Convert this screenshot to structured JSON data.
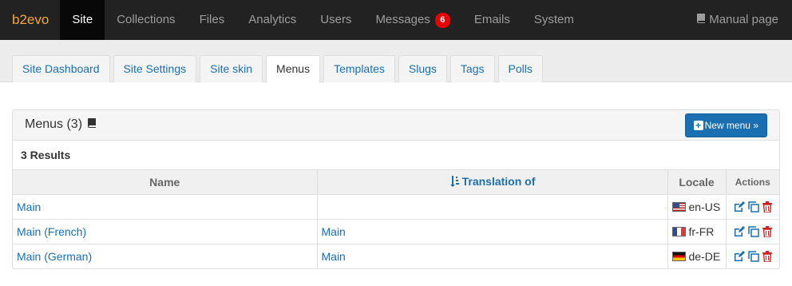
{
  "nav": {
    "brand": "b2evo",
    "items": [
      {
        "label": "Site",
        "active": true
      },
      {
        "label": "Collections"
      },
      {
        "label": "Files"
      },
      {
        "label": "Analytics"
      },
      {
        "label": "Users"
      },
      {
        "label": "Messages",
        "badge": "6"
      },
      {
        "label": "Emails"
      },
      {
        "label": "System"
      }
    ],
    "manual_label": "Manual page"
  },
  "tabs": [
    "Site Dashboard",
    "Site Settings",
    "Site skin",
    "Menus",
    "Templates",
    "Slugs",
    "Tags",
    "Polls"
  ],
  "active_tab": "Menus",
  "panel": {
    "title": "Menus (3)",
    "new_button": "New menu »",
    "results": "3 Results"
  },
  "table": {
    "headers": {
      "name": "Name",
      "translation": "Translation of",
      "locale": "Locale",
      "actions": "Actions"
    },
    "rows": [
      {
        "name": "Main",
        "translation": "",
        "locale": "en-US",
        "flag": "us"
      },
      {
        "name": "Main (French)",
        "translation": "Main",
        "locale": "fr-FR",
        "flag": "fr"
      },
      {
        "name": "Main (German)",
        "translation": "Main",
        "locale": "de-DE",
        "flag": "de"
      }
    ]
  },
  "colors": {
    "accent": "#1a6fb0",
    "brand": "#f4a83a",
    "navbar": "#222222",
    "badge": "#ee0000",
    "delete": "#cc2222"
  }
}
